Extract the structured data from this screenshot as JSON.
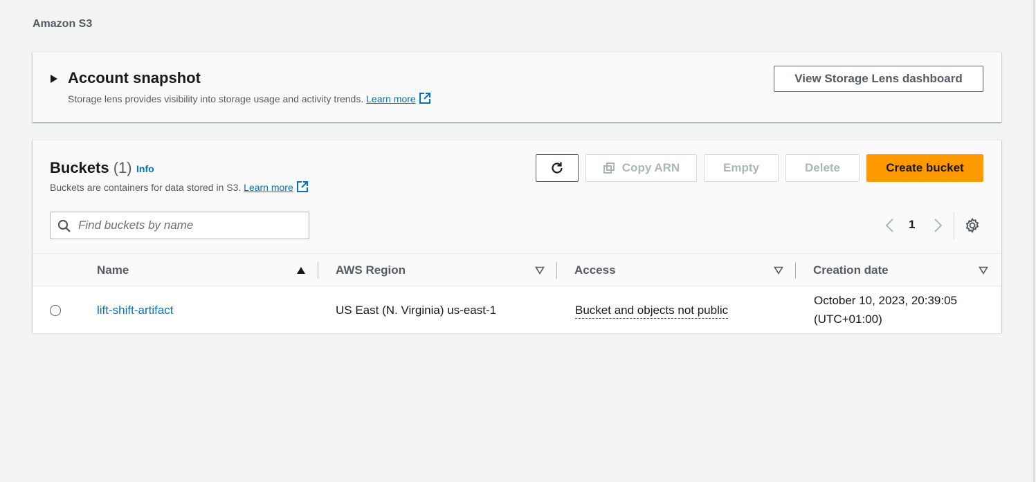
{
  "breadcrumb": "Amazon S3",
  "snapshot": {
    "title": "Account snapshot",
    "description": "Storage lens provides visibility into storage usage and activity trends. ",
    "learn_more": "Learn more",
    "dashboard_button": "View Storage Lens dashboard"
  },
  "buckets": {
    "title": "Buckets",
    "count": "(1)",
    "info": "Info",
    "description": "Buckets are containers for data stored in S3. ",
    "learn_more": "Learn more",
    "actions": {
      "copy_arn": "Copy ARN",
      "empty": "Empty",
      "delete": "Delete",
      "create": "Create bucket"
    },
    "search_placeholder": "Find buckets by name",
    "page": "1",
    "columns": [
      "Name",
      "AWS Region",
      "Access",
      "Creation date"
    ],
    "rows": [
      {
        "name": "lift-shift-artifact",
        "region": "US East (N. Virginia) us-east-1",
        "access": "Bucket and objects not public",
        "created_line1": "October 10, 2023, 20:39:05",
        "created_line2": "(UTC+01:00)"
      }
    ]
  },
  "colors": {
    "accent_link": "#0073bb",
    "primary_button": "#ff9900",
    "page_background": "#f2f3f3"
  },
  "icons": [
    "caret-right-icon",
    "external-link-icon",
    "refresh-icon",
    "copy-icon",
    "search-icon",
    "chevron-left-icon",
    "chevron-right-icon",
    "settings-gear-icon",
    "sort-ascending-icon",
    "sort-descending-icon"
  ]
}
